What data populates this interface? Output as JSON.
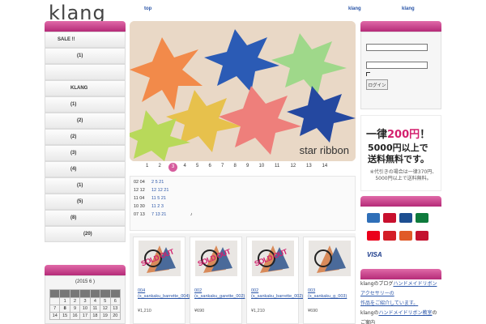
{
  "logo": "klang",
  "topnav": [
    "top",
    "klang",
    "klang"
  ],
  "left_menu": {
    "items": [
      {
        "label": "SALE !!",
        "indent": 1
      },
      {
        "label": "(1)",
        "indent": 4
      },
      {
        "label": "",
        "indent": 0
      },
      {
        "label": "KLANG",
        "indent": 3
      },
      {
        "label": "(1)",
        "indent": 3
      },
      {
        "label": "(2)",
        "indent": 4
      },
      {
        "label": "(2)",
        "indent": 3
      },
      {
        "label": "(3)",
        "indent": 3
      },
      {
        "label": "(4)",
        "indent": 3
      },
      {
        "label": "(1)",
        "indent": 4
      },
      {
        "label": "(5)",
        "indent": 4
      },
      {
        "label": "(8)",
        "indent": 3
      },
      {
        "label": "(20)",
        "indent": 5
      }
    ]
  },
  "calendar": {
    "title": "(2015 6 )",
    "rows": [
      [
        "",
        "1",
        "2",
        "3",
        "4",
        "5",
        "6"
      ],
      [
        "7",
        "8",
        "9",
        "10",
        "11",
        "12",
        "13"
      ],
      [
        "14",
        "15",
        "16",
        "17",
        "18",
        "19",
        "20"
      ]
    ],
    "today": "8"
  },
  "hero": {
    "caption": "star ribbon"
  },
  "pager": {
    "pages": [
      "1",
      "2",
      "3",
      "4",
      "5",
      "6",
      "7",
      "8",
      "9",
      "10",
      "11",
      "12",
      "13",
      "14"
    ],
    "current": "3"
  },
  "news": [
    {
      "date": "02 04",
      "text": "2 5 21"
    },
    {
      "date": "12 12",
      "text": "12 12 21"
    },
    {
      "date": "11 04",
      "text": "11 5 21"
    },
    {
      "date": "10 30",
      "text": "11 2 3"
    },
    {
      "date": "07 13",
      "text": "7 13 21",
      "note": "♪"
    }
  ],
  "products": [
    {
      "name": "004 (s_sankaku_barrette_004)",
      "price": "¥1,210",
      "sold_out": true,
      "sold_label": "SOLD OUT"
    },
    {
      "name": "002 (s_sankaku_garette_002)",
      "price": "¥690",
      "sold_out": true,
      "sold_label": "SOLD OUT"
    },
    {
      "name": "002 (s_sankaku_barrette_002)",
      "price": "¥1,210",
      "sold_out": true,
      "sold_label": "SOLD OUT"
    },
    {
      "name": "003 (s_sankaku_g_003)",
      "price": "¥690",
      "sold_out": false,
      "sold_label": ""
    }
  ],
  "login": {
    "button": "ログイン"
  },
  "promo": {
    "line1_pre": "一律",
    "line1_hl": "200円",
    "line1_post": "！",
    "line2a": "5000円以上で",
    "line2b": "送料無料です。",
    "line3a": "※代引きの場合は一律370円、",
    "line3b": "5000円以上で送料無料。"
  },
  "payment": {
    "cards": [
      "AMEX",
      "DC",
      "DINERS",
      "JCB",
      "MC",
      "UC",
      "NICOS",
      "UFJ"
    ],
    "visa": "VISA",
    "colors": {
      "amex": "#2f6fb8",
      "dc": "#c8102e",
      "diners": "#1d4f91",
      "jcb": "#0e7a3c",
      "mc": "#eb001b",
      "uc": "#d41f27",
      "nicos": "#e05a28",
      "ufj": "#c4122f"
    }
  },
  "info": {
    "line1_pre": "klangのブログ",
    "line1_link": "ハンドメイドリボンアクセサリーの",
    "line1_link2": "作品をご紹介しています。",
    "line2_pre": "klangの",
    "line2_link": "ハンドメイドリボン教室",
    "line2_link2": "のご案内"
  },
  "colors": {
    "accent": "#d3206e",
    "link": "#2a55a8",
    "pink_bar": "#c43c88"
  }
}
